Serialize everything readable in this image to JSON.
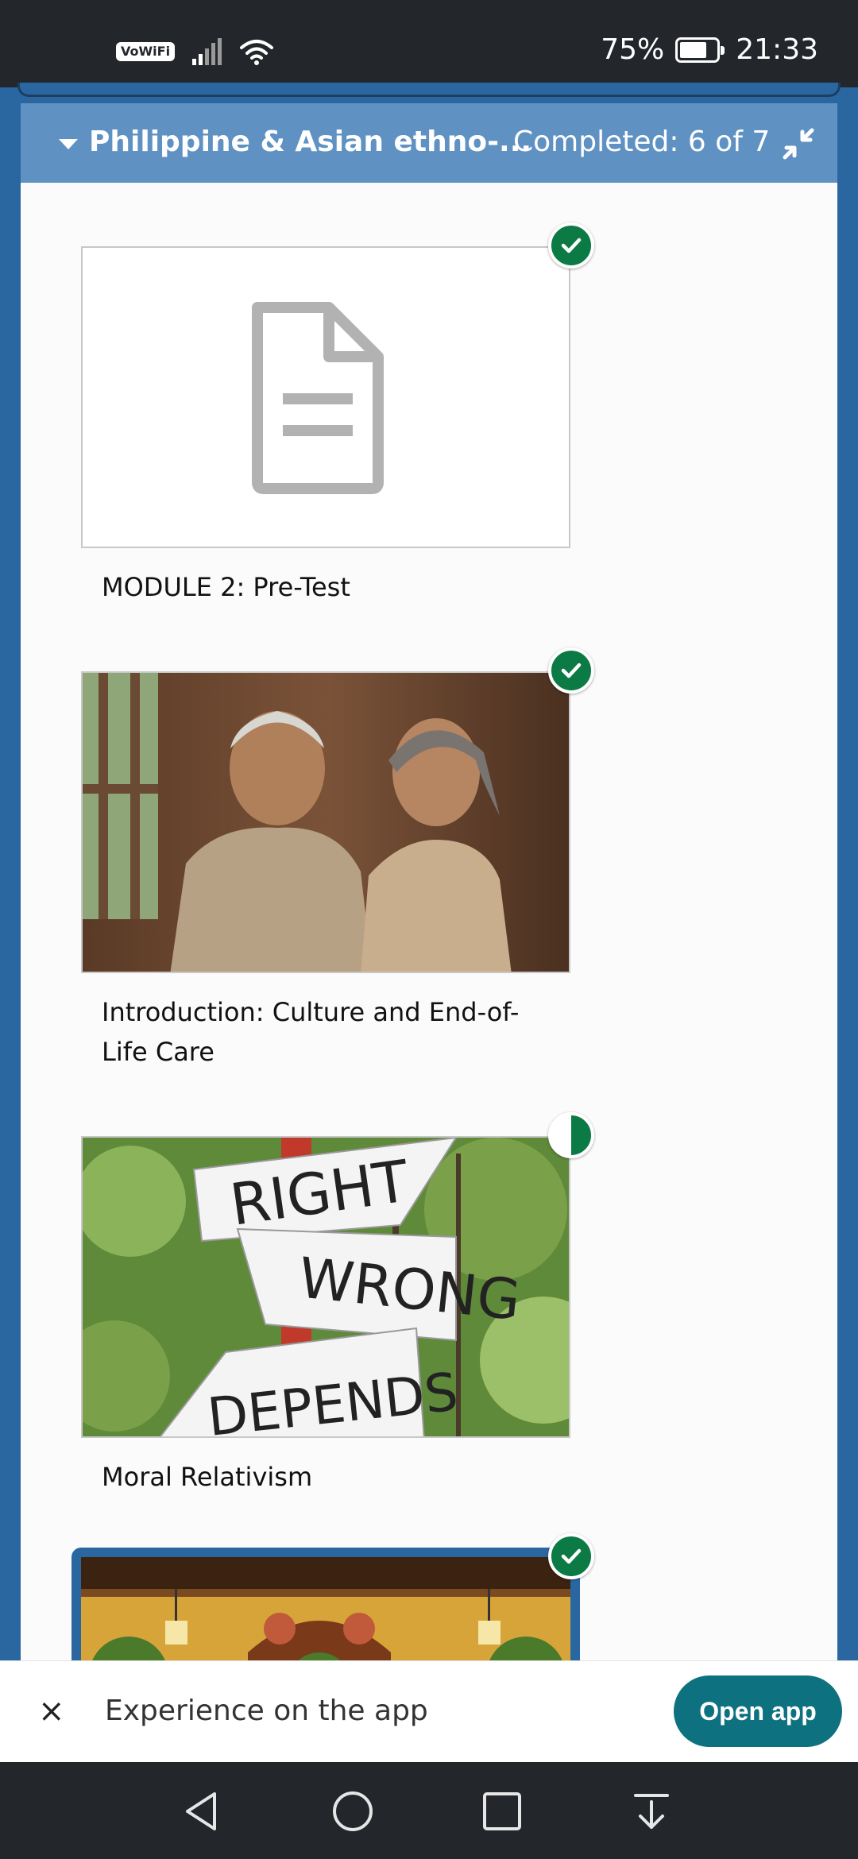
{
  "status_bar": {
    "vowifi": "VoWiFi",
    "battery": "75%",
    "time": "21:33"
  },
  "section": {
    "title": "Philippine & Asian ethno-...",
    "completed": "Completed: 6 of 7"
  },
  "cards": [
    {
      "label": "MODULE 2: Pre-Test",
      "status": "complete",
      "thumbnail": "document-icon"
    },
    {
      "label": "Introduction: Culture and End-of-Life Care",
      "status": "complete",
      "thumbnail": "elderly-couple-photo"
    },
    {
      "label": "Moral Relativism",
      "status": "in-progress",
      "thumbnail": "signpost-photo",
      "sign_words": [
        "RIGHT",
        "WRONG",
        "DEPENDS"
      ]
    },
    {
      "label": "",
      "status": "complete",
      "thumbnail": "interior-photo"
    }
  ],
  "banner": {
    "close": "×",
    "text": "Experience on the app",
    "button": "Open app"
  },
  "colors": {
    "header_blue": "#5f92c2",
    "frame_blue": "#2a67a1",
    "complete_green": "#0c7a45",
    "app_button": "#0e7180"
  }
}
